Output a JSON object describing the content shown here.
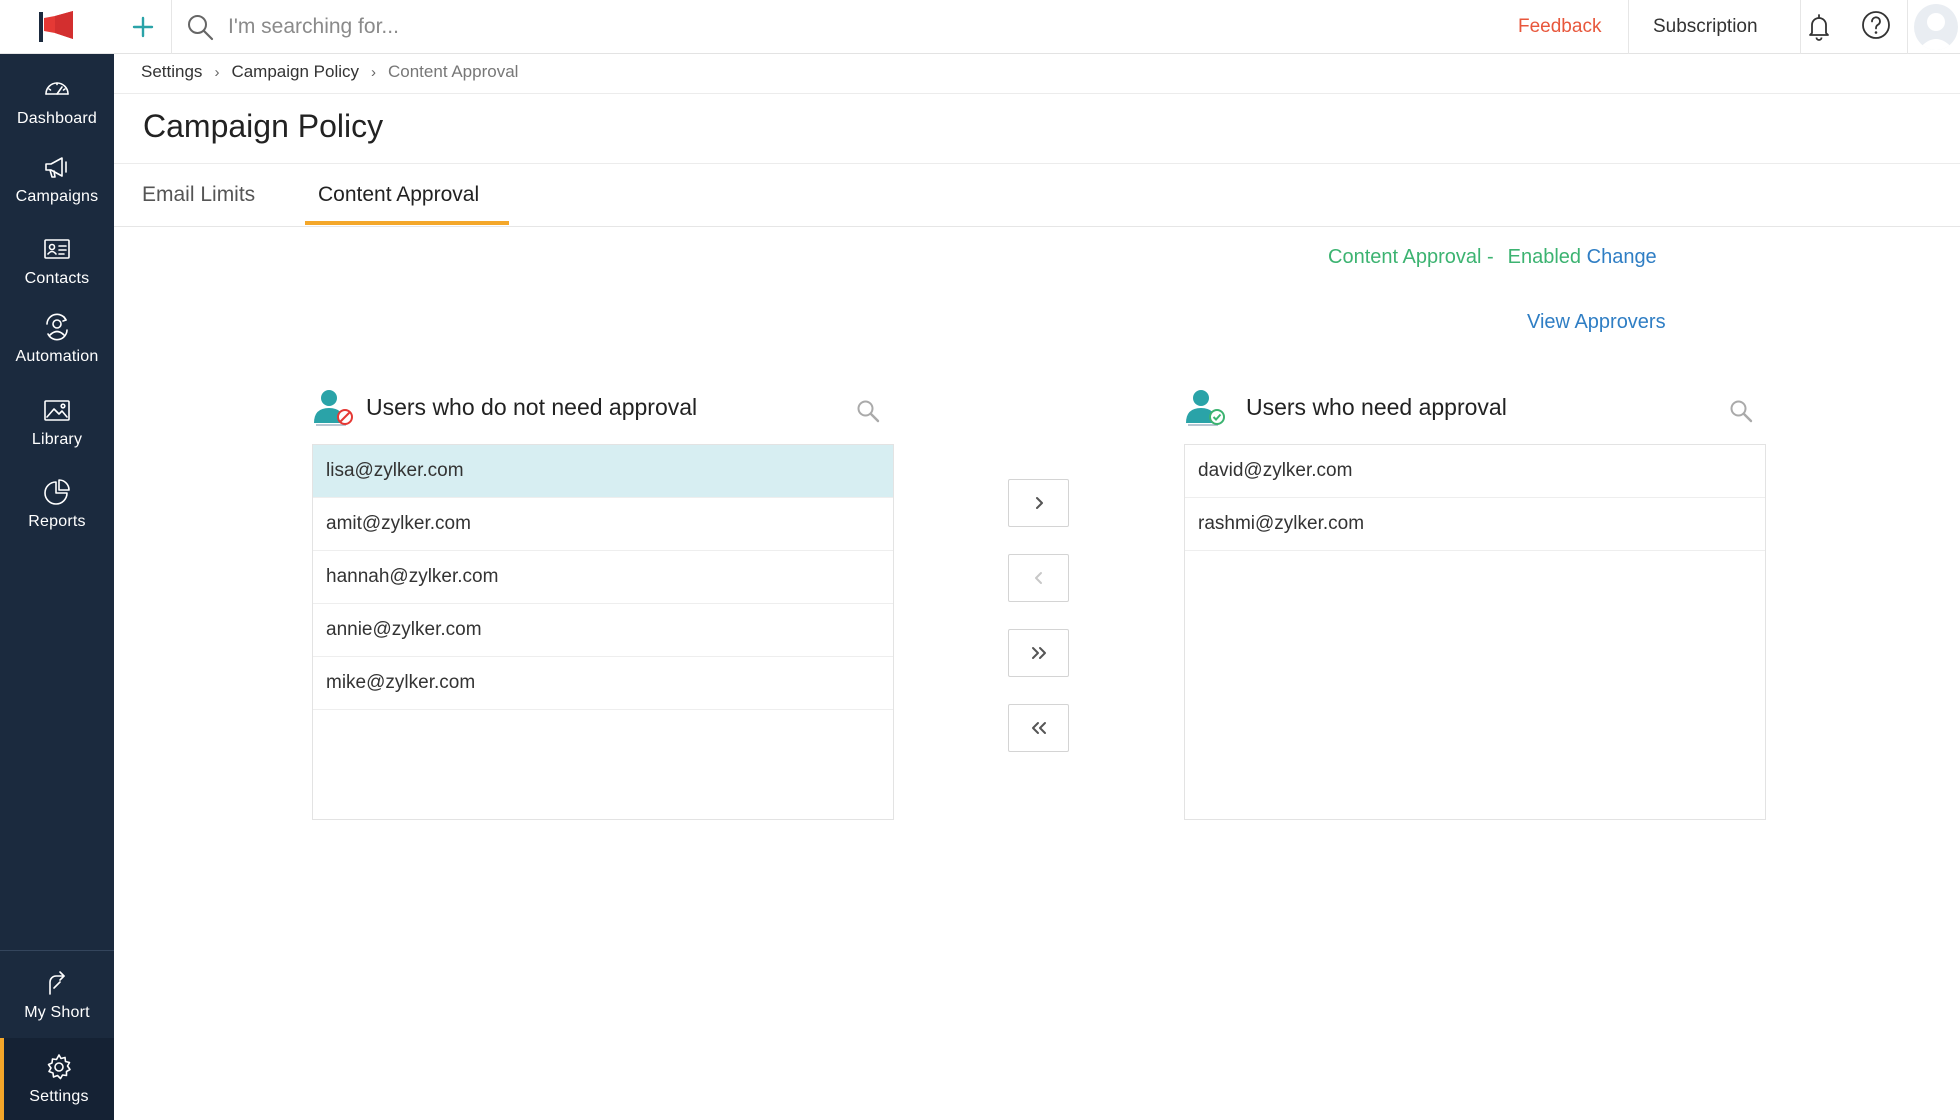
{
  "sidebar": {
    "logo": "megaphone-logo",
    "items": [
      {
        "label": "Dashboard",
        "icon": "gauge-icon"
      },
      {
        "label": "Campaigns",
        "icon": "megaphone-icon"
      },
      {
        "label": "Contacts",
        "icon": "contact-card-icon"
      },
      {
        "label": "Automation",
        "icon": "automation-icon"
      },
      {
        "label": "Library",
        "icon": "image-icon"
      },
      {
        "label": "Reports",
        "icon": "pie-chart-icon"
      }
    ],
    "bottom_items": [
      {
        "label": "My Short",
        "icon": "shortcut-icon"
      },
      {
        "label": "Settings",
        "icon": "gear-icon"
      }
    ],
    "active": "Settings"
  },
  "header": {
    "search_placeholder": "I'm searching for...",
    "feedback": "Feedback",
    "subscription": "Subscription"
  },
  "breadcrumb": [
    "Settings",
    "Campaign Policy",
    "Content Approval"
  ],
  "page_title": "Campaign Policy",
  "tabs": [
    {
      "label": "Email Limits",
      "active": false
    },
    {
      "label": "Content Approval",
      "active": true
    }
  ],
  "status": {
    "label": "Content Approval -",
    "value": "Enabled",
    "change_link": "Change"
  },
  "view_approvers": "View Approvers",
  "left_list": {
    "title": "Users who do not need approval",
    "items": [
      "lisa@zylker.com",
      "amit@zylker.com",
      "hannah@zylker.com",
      "annie@zylker.com",
      "mike@zylker.com"
    ],
    "selected": "lisa@zylker.com"
  },
  "right_list": {
    "title": "Users who need approval",
    "items": [
      "david@zylker.com",
      "rashmi@zylker.com"
    ]
  },
  "transfer_buttons": [
    {
      "icon": "chevron-right-icon",
      "enabled": true
    },
    {
      "icon": "chevron-left-icon",
      "enabled": false
    },
    {
      "icon": "double-chevron-right-icon",
      "enabled": true
    },
    {
      "icon": "double-chevron-left-icon",
      "enabled": true
    }
  ],
  "colors": {
    "sidebar_bg": "#1b2a3e",
    "accent": "#f4a72a",
    "link": "#2f7ec4",
    "enabled_green": "#3cb371",
    "feedback_red": "#e8573c",
    "selected_row": "#d7eef2",
    "user_icon_teal": "#2aa3a8"
  }
}
